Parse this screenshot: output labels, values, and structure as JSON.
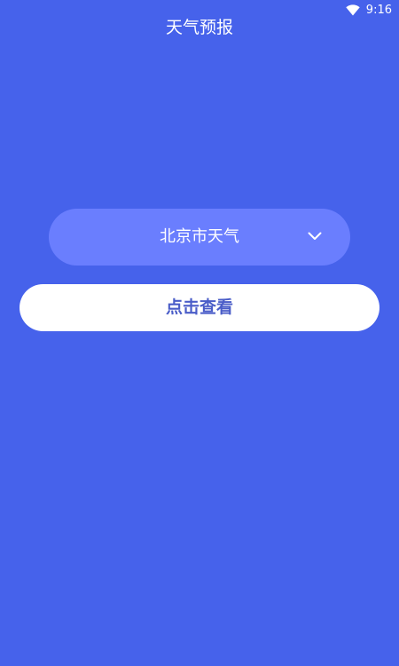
{
  "status_bar": {
    "time": "9:16",
    "icons": [
      "wifi-icon"
    ]
  },
  "header": {
    "title": "天气预报"
  },
  "city_select": {
    "selected_value": "北京市天气",
    "icon": "chevron-down-icon"
  },
  "actions": {
    "view_button_label": "点击查看"
  },
  "colors": {
    "background": "#4662EB",
    "select_background": "#6A7EFE",
    "button_background": "#FFFFFF",
    "button_text": "#4A5DC8",
    "text_on_background": "#FFFFFF"
  }
}
